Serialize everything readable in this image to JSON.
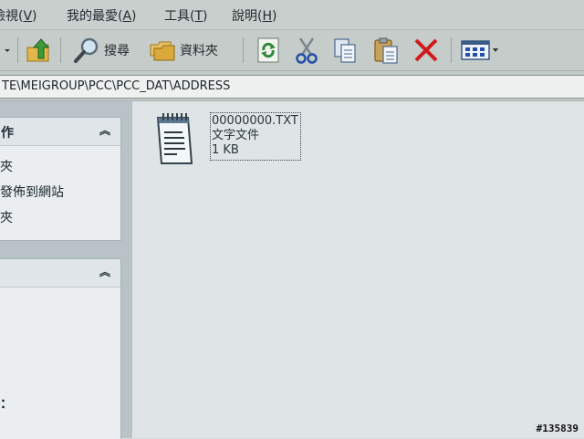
{
  "menubar": {
    "items": [
      {
        "label": "檢視(",
        "accel": "V",
        "tail": ")"
      },
      {
        "label": "我的最愛(",
        "accel": "A",
        "tail": ")"
      },
      {
        "label": "工具(",
        "accel": "T",
        "tail": ")"
      },
      {
        "label": "說明(",
        "accel": "H",
        "tail": ")"
      }
    ]
  },
  "toolbar": {
    "search_label": "搜尋",
    "folders_label": "資料夾",
    "icons": [
      "dropdown-arrow-icon",
      "up-folder-icon",
      "search-icon",
      "folders-icon",
      "refresh-icon",
      "cut-icon",
      "copy-icon",
      "paste-icon",
      "delete-icon",
      "views-icon"
    ]
  },
  "address": {
    "path": "TE\\MEIGROUP\\PCC\\PCC_DAT\\ADDRESS"
  },
  "left_panel": {
    "tasks_title": "作",
    "tasks": [
      "夾",
      "發佈到網站",
      "夾"
    ],
    "other_partial": "："
  },
  "file": {
    "name": "00000000.TXT",
    "type": "文字文件",
    "size": "1 KB"
  },
  "watermark": "#135839",
  "colors": {
    "delete_red": "#d01a1a",
    "refresh_green": "#2f8a3a",
    "cut_blue": "#2450a8"
  }
}
